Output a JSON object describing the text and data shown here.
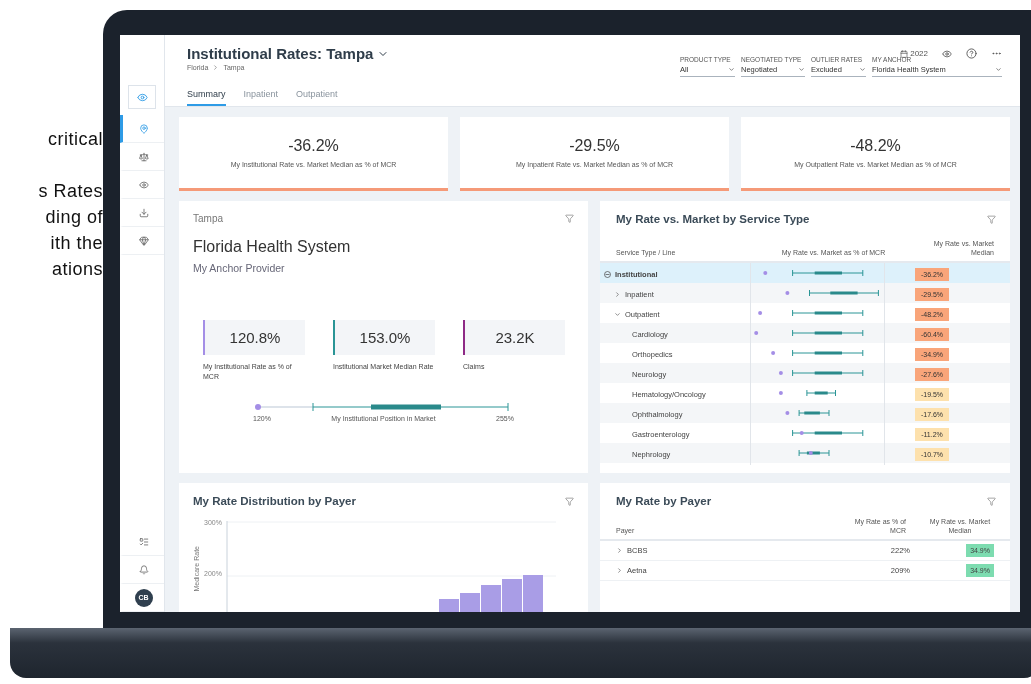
{
  "side_text": [
    "critical",
    "s Rates",
    "ding of",
    "ith the",
    "ations"
  ],
  "sidebar": {
    "items": [
      {
        "selected": false
      },
      {
        "selected": true
      },
      {
        "selected": false
      },
      {
        "selected": false
      },
      {
        "selected": false
      },
      {
        "selected": false
      }
    ],
    "bottom_items": [
      {
        "kind": "edit"
      },
      {
        "kind": "bell"
      },
      {
        "kind": "avatar",
        "initials": "CB"
      }
    ]
  },
  "header": {
    "title": "Institutional Rates: Tampa",
    "breadcrumb": [
      "Florida",
      "Tampa"
    ],
    "year": "2022"
  },
  "filters": [
    {
      "label": "PRODUCT TYPE",
      "value": "All"
    },
    {
      "label": "NEGOTIATED TYPE",
      "value": "Negotiated"
    },
    {
      "label": "OUTLIER RATES",
      "value": "Excluded"
    },
    {
      "label": "MY ANCHOR",
      "value": "Florida Health System"
    }
  ],
  "tabs": [
    {
      "label": "Summary",
      "selected": true
    },
    {
      "label": "Inpatient",
      "selected": false
    },
    {
      "label": "Outpatient",
      "selected": false
    }
  ],
  "kpis": [
    {
      "value": "-36.2%",
      "label": "My Institutional Rate vs. Market Median as % of MCR"
    },
    {
      "value": "-29.5%",
      "label": "My Inpatient Rate vs. Market Median as % of MCR"
    },
    {
      "value": "-48.2%",
      "label": "My Outpatient Rate vs. Market Median as % of MCR"
    }
  ],
  "anchor_card": {
    "region": "Tampa",
    "title": "Florida Health System",
    "subtitle": "My Anchor Provider",
    "stats": [
      {
        "value": "120.8%",
        "label": "My Institutional Rate as % of MCR",
        "color": "#a48ee6"
      },
      {
        "value": "153.0%",
        "label": "Institutional Market Median Rate",
        "color": "#2a9596"
      },
      {
        "value": "23.2K",
        "label": "Claims",
        "color": "#8e2a86"
      }
    ],
    "position": {
      "min": "120%",
      "caption": "My Institutional Position in Market",
      "max": "255%"
    }
  },
  "service_table": {
    "title": "My Rate vs. Market by Service Type",
    "columns": [
      "Service Type / Line",
      "My Rate vs. Market as % of MCR",
      "My Rate vs. Market Median"
    ],
    "rows": [
      {
        "name": "Institutional",
        "expanded": true,
        "selected": true,
        "value": "-36.2%",
        "color": "#f9a57a",
        "children": [
          {
            "name": "Inpatient",
            "expanded": false,
            "selected": false,
            "value": "-29.5%",
            "color": "#f9a57a"
          },
          {
            "name": "Outpatient",
            "expanded": true,
            "selected": false,
            "value": "-48.2%",
            "color": "#f9a57a",
            "children": [
              {
                "name": "Cardiology",
                "selected": false,
                "value": "-60.4%",
                "color": "#f9a57a"
              },
              {
                "name": "Orthopedics",
                "selected": false,
                "value": "-34.9%",
                "color": "#f9a57a"
              },
              {
                "name": "Neurology",
                "selected": false,
                "value": "-27.6%",
                "color": "#f9a57a"
              },
              {
                "name": "Hematology/Oncology",
                "selected": false,
                "value": "-19.5%",
                "color": "#fde1ad"
              },
              {
                "name": "Ophthalmology",
                "selected": false,
                "value": "-17.6%",
                "color": "#fde1ad"
              },
              {
                "name": "Gastroenterology",
                "selected": false,
                "value": "-11.2%",
                "color": "#fde1ad"
              },
              {
                "name": "Nephrology",
                "selected": false,
                "value": "-10.7%",
                "color": "#fde1ad"
              }
            ]
          }
        ]
      }
    ]
  },
  "distribution": {
    "title": "My Rate Distribution by Payer",
    "yticks": [
      "300%",
      "200%"
    ],
    "ylabel": "Medicare Rate"
  },
  "payer_table": {
    "title": "My Rate by Payer",
    "columns": [
      "Payer",
      "My Rate as % of MCR",
      "My Rate vs. Market Median"
    ],
    "rows": [
      {
        "name": "BCBS",
        "rate": "222%",
        "value": "34.9%"
      },
      {
        "name": "Aetna",
        "rate": "209%",
        "value": "34.9%"
      }
    ]
  }
}
